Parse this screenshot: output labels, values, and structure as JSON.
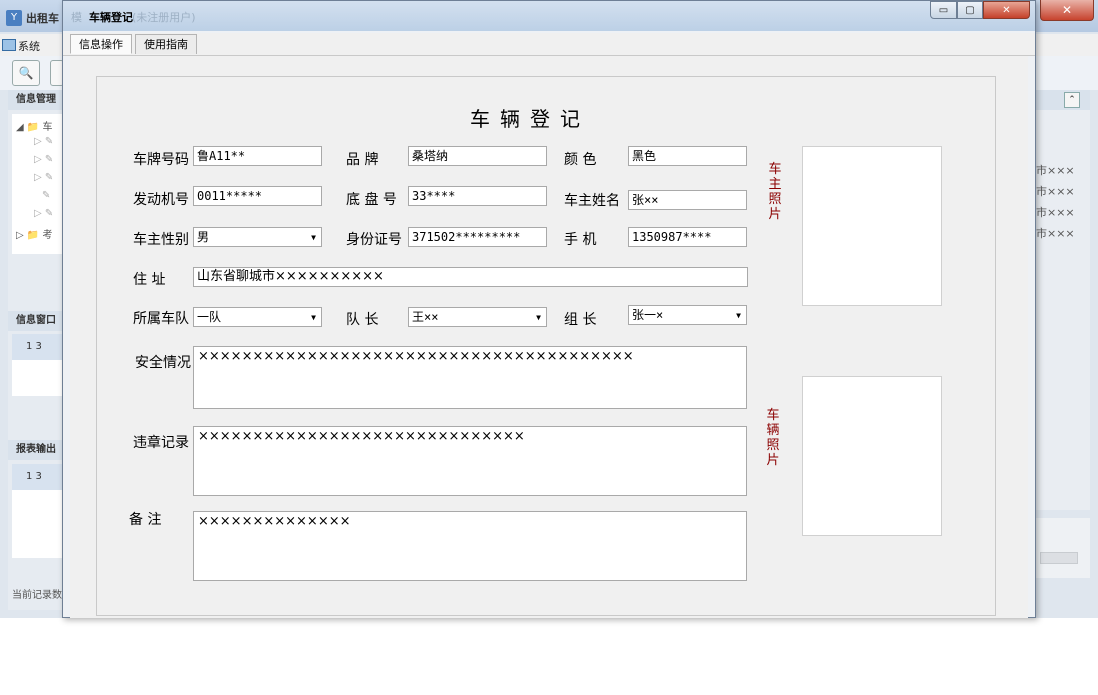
{
  "background_window": {
    "title": "出租车",
    "menu_system": "系统",
    "left_panel": {
      "info_mgmt_header": "信息管理",
      "tree_items": [
        "车",
        "考"
      ],
      "info_window_header": "信息窗口",
      "info_window_row": "1    3",
      "report_header": "报表输出",
      "report_row": "1    3",
      "status_text": "当前记录数"
    },
    "right_panel": {
      "rows": [
        "市×××",
        "市×××",
        "市×××",
        "市×××"
      ]
    }
  },
  "dialog": {
    "title": "车辆登记",
    "ghost_title_left": "模",
    "ghost_title_right": "(未注册用户)",
    "tabs": [
      "信息操作",
      "使用指南"
    ],
    "form": {
      "heading": "车辆登记",
      "plate_label": "车牌号码",
      "plate_value": "鲁A11**",
      "brand_label": "品  牌",
      "brand_value": "桑塔纳",
      "color_label": "颜 色",
      "color_value": "黑色",
      "engine_label": "发动机号",
      "engine_value": "0011*****",
      "chassis_label": "底 盘 号",
      "chassis_value": "33****",
      "owner_label": "车主姓名",
      "owner_value": "张××",
      "gender_label": "车主性别",
      "gender_value": "男",
      "id_label": "身份证号",
      "id_value": "371502*********",
      "phone_label": "手  机",
      "phone_value": "1350987****",
      "address_label": "住  址",
      "address_value": "山东省聊城市××××××××××",
      "fleet_label": "所属车队",
      "fleet_value": "一队",
      "captain_label": "队  长",
      "captain_value": "王××",
      "leader_label": "组  长",
      "leader_value": "张一×",
      "safety_label": "安全情况",
      "safety_value": "××××××××××××××××××××××××××××××××××××××××",
      "violation_label": "违章记录",
      "violation_value": "××××××××××××××××××××××××××××××",
      "remark_label": "备  注",
      "remark_value": "××××××××××××××",
      "owner_photo_label": "车主照片",
      "vehicle_photo_label": "车辆照片"
    }
  }
}
